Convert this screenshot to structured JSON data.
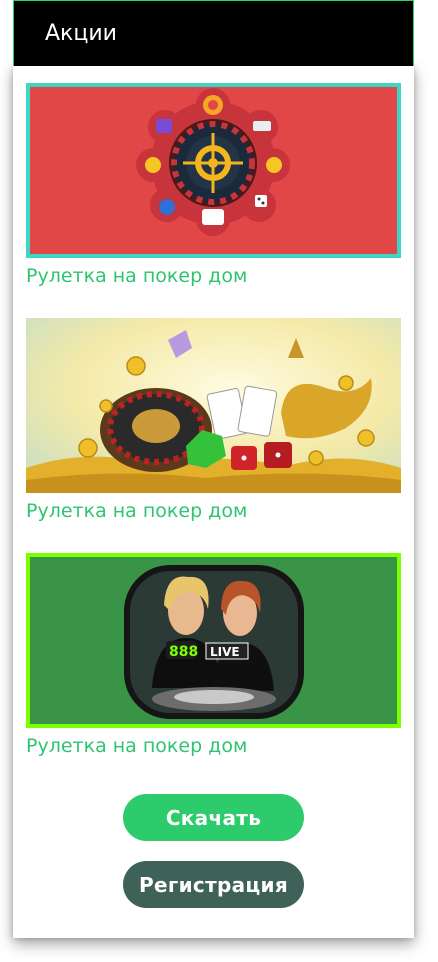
{
  "header": {
    "title": "Акции"
  },
  "promos": [
    {
      "title": "Рулетка на покер дом",
      "image": "roulette-casino-icons-banner"
    },
    {
      "title": "Рулетка на покер дом",
      "image": "roulette-gold-coins-banner"
    },
    {
      "title": "Рулетка на покер дом",
      "image": "888-live-casino-dealers-banner"
    }
  ],
  "buttons": {
    "download": "Скачать",
    "register": "Регистрация"
  },
  "colors": {
    "accent": "#2ecb6c",
    "register": "#3e6158",
    "title_green": "#2fc46f",
    "banner1_bg": "#e14747",
    "banner1_border": "#3dd6c4",
    "banner3_bg": "#3a9447",
    "banner3_border": "#7cff00"
  }
}
